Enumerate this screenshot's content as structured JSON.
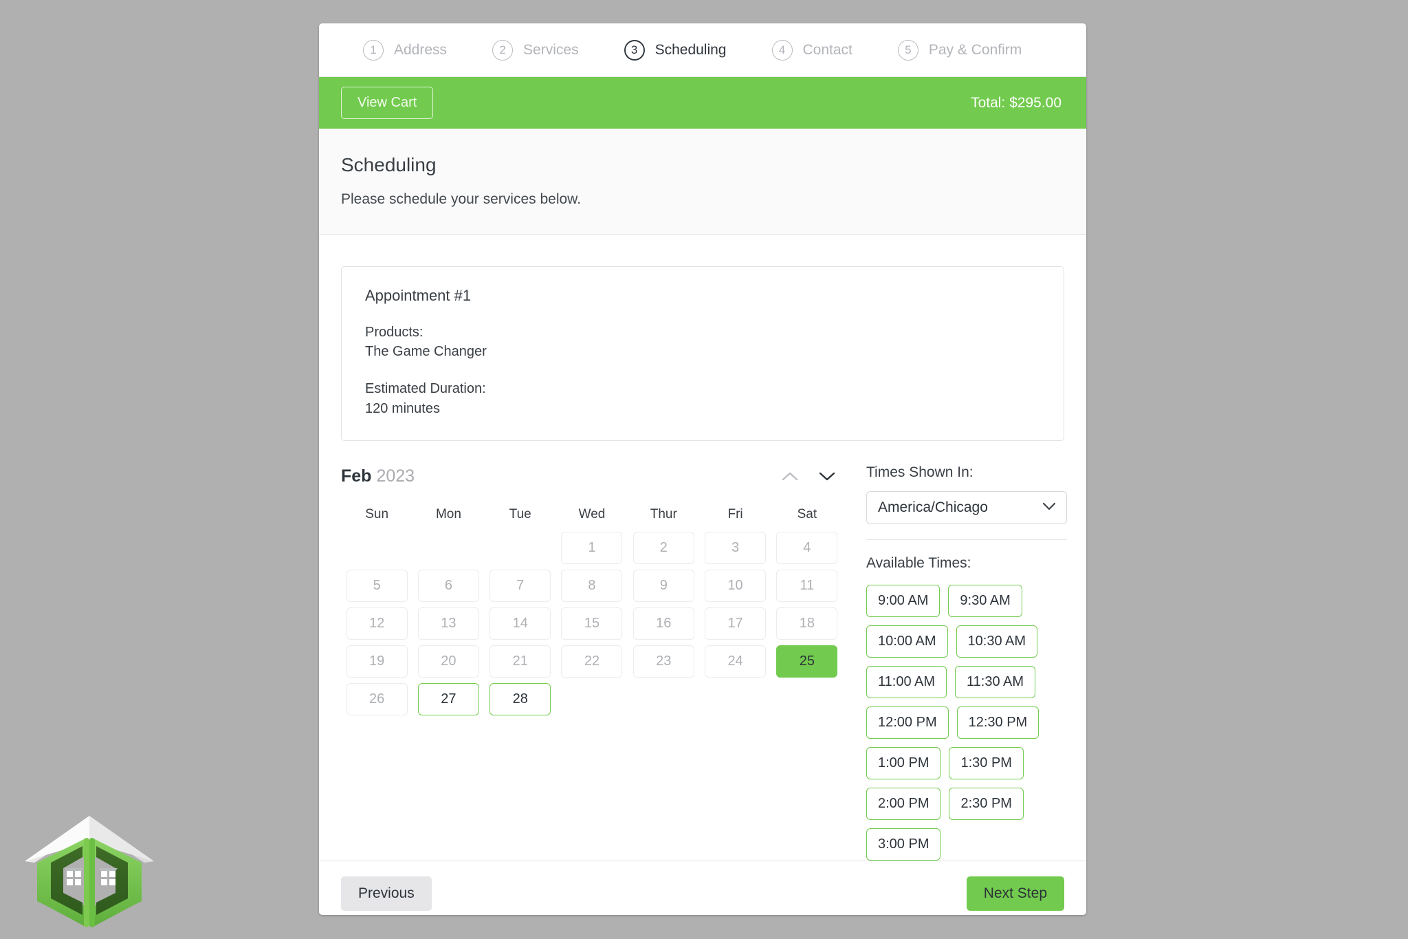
{
  "theme": {
    "accent_green": "#72cb4e",
    "page_background": "#b0b0b0",
    "muted_text": "#b2b4ba",
    "dark_text": "#2e343b"
  },
  "logo": {
    "name": "company-logo",
    "alt": "Green house bracket logo"
  },
  "steps": [
    {
      "number": "1",
      "label": "Address",
      "active": false
    },
    {
      "number": "2",
      "label": "Services",
      "active": false
    },
    {
      "number": "3",
      "label": "Scheduling",
      "active": true
    },
    {
      "number": "4",
      "label": "Contact",
      "active": false
    },
    {
      "number": "5",
      "label": "Pay & Confirm",
      "active": false
    }
  ],
  "cartbar": {
    "view_cart_label": "View Cart",
    "total_label": "Total: $295.00"
  },
  "section": {
    "title": "Scheduling",
    "subtitle": "Please schedule your services below."
  },
  "appointment": {
    "title": "Appointment #1",
    "products_label": "Products:",
    "products_value": "The Game Changer",
    "duration_label": "Estimated Duration:",
    "duration_value": "120 minutes"
  },
  "calendar": {
    "month": "Feb",
    "year": "2023",
    "prev_icon": "chevron-up-icon",
    "next_icon": "chevron-down-icon",
    "day_headers": [
      "Sun",
      "Mon",
      "Tue",
      "Wed",
      "Thur",
      "Fri",
      "Sat"
    ],
    "leading_blanks": 3,
    "days": [
      {
        "label": "1",
        "state": "disabled"
      },
      {
        "label": "2",
        "state": "disabled"
      },
      {
        "label": "3",
        "state": "disabled"
      },
      {
        "label": "4",
        "state": "disabled"
      },
      {
        "label": "5",
        "state": "disabled"
      },
      {
        "label": "6",
        "state": "disabled"
      },
      {
        "label": "7",
        "state": "disabled"
      },
      {
        "label": "8",
        "state": "disabled"
      },
      {
        "label": "9",
        "state": "disabled"
      },
      {
        "label": "10",
        "state": "disabled"
      },
      {
        "label": "11",
        "state": "disabled"
      },
      {
        "label": "12",
        "state": "disabled"
      },
      {
        "label": "13",
        "state": "disabled"
      },
      {
        "label": "14",
        "state": "disabled"
      },
      {
        "label": "15",
        "state": "disabled"
      },
      {
        "label": "16",
        "state": "disabled"
      },
      {
        "label": "17",
        "state": "disabled"
      },
      {
        "label": "18",
        "state": "disabled"
      },
      {
        "label": "19",
        "state": "disabled"
      },
      {
        "label": "20",
        "state": "disabled"
      },
      {
        "label": "21",
        "state": "disabled"
      },
      {
        "label": "22",
        "state": "disabled"
      },
      {
        "label": "23",
        "state": "disabled"
      },
      {
        "label": "24",
        "state": "disabled"
      },
      {
        "label": "25",
        "state": "selected"
      },
      {
        "label": "26",
        "state": "disabled"
      },
      {
        "label": "27",
        "state": "available"
      },
      {
        "label": "28",
        "state": "available"
      }
    ]
  },
  "times_panel": {
    "timezone_label": "Times Shown In:",
    "timezone_value": "America/Chicago",
    "timezone_caret_icon": "chevron-down-icon",
    "available_label": "Available Times:",
    "slots": [
      "9:00 AM",
      "9:30 AM",
      "10:00 AM",
      "10:30 AM",
      "11:00 AM",
      "11:30 AM",
      "12:00 PM",
      "12:30 PM",
      "1:00 PM",
      "1:30 PM",
      "2:00 PM",
      "2:30 PM",
      "3:00 PM"
    ]
  },
  "footer": {
    "previous_label": "Previous",
    "next_label": "Next Step"
  }
}
